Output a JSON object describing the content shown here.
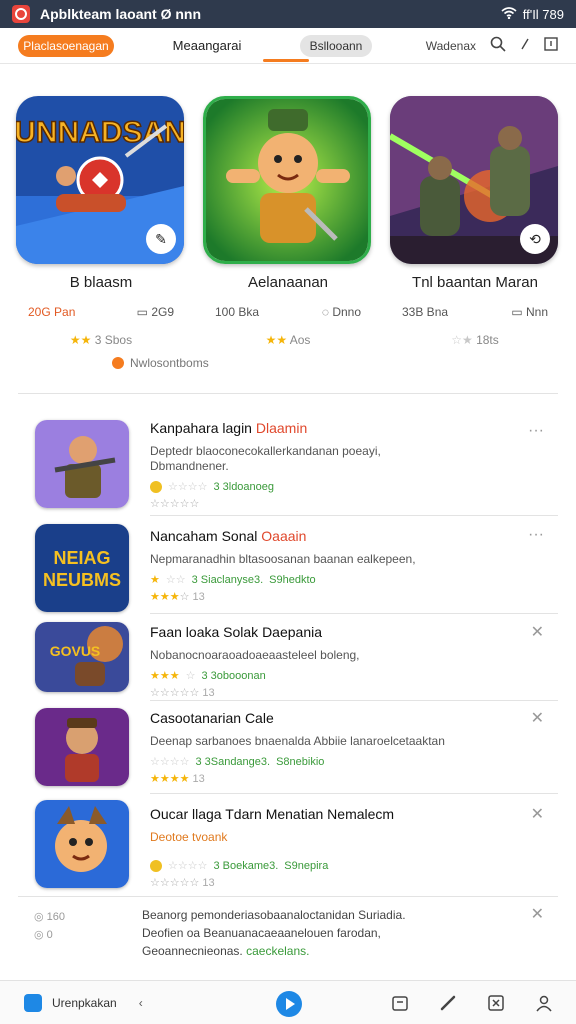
{
  "status_bar": {
    "title": "Apblkteam laoant Ø nnn",
    "right_text": "ff'Il 789"
  },
  "tabs": {
    "active": "Placlasoenagan",
    "plain": "Meaangarai",
    "grey": "Bsllooann",
    "right_label": "Wadenax"
  },
  "featured": [
    {
      "title": "B blaasm",
      "price": "20G Pan",
      "stat": "2G9",
      "rating_text": "3 Sbos",
      "cover_text": "UNNADSAN"
    },
    {
      "title": "Aelanaanan",
      "price": "100 Bka",
      "stat": "Dnno",
      "rating_text": "Aos",
      "cover_text": ""
    },
    {
      "title": "Tnl baantan Maran",
      "price": "33B Bna",
      "stat": "Nnn",
      "rating_text": "18ts",
      "cover_text": ""
    }
  ],
  "featured_note": "Nwlosontboms",
  "list": [
    {
      "title": "Kanpahara lagin",
      "title_accent": "Dlaamin",
      "desc": "Deptedr blaoconecokallerkandanan poeayi,\nDbmandnener.",
      "stats": "3 3ldoanoeg",
      "extra": "",
      "action": "···"
    },
    {
      "title": "Nancaham Sonal",
      "title_accent": "Oaaain",
      "desc": "Nepmaranadhin bltasoosanan baanan ealkepeen,",
      "stats": "3 Siaclanyse3.",
      "extra": "S9hedkto",
      "action": "···"
    },
    {
      "title": "Faan loaka Solak Daepania",
      "title_accent": "",
      "desc": "Nobanocnoaraoadoaeaasteleel boleng,",
      "stats": "3 3obooonan",
      "extra": "",
      "action": "✕"
    },
    {
      "title": "Casootanarian Cale",
      "title_accent": "",
      "desc": "Deenap sarbanoes bnaenalda Abbiie lanaroelcetaaktan",
      "stats": "3 3Sandange3.",
      "extra": "S8nebikio",
      "action": "✕"
    },
    {
      "title": "Oucar llaga Tdarn Menatian Nemalecm",
      "title_accent": "",
      "desc": "Deotoe tvoank",
      "stats": "3 Boekame3.",
      "extra": "S9nepira",
      "action": "✕"
    }
  ],
  "footer_block": {
    "left_a": "160",
    "left_b": "0",
    "line1": "Beanorg pemonderiasobaanaloctanidan Suriadia.",
    "line2": "Deofien oa Beanuanacaeaanelouen farodan,",
    "line3_prefix": "Geoannecnieonas.",
    "line3_accent": "caeckelans.",
    "action": "✕"
  },
  "bottom_bar": {
    "label": "Urenpkakan",
    "chev": "‹"
  },
  "colors": {
    "accent": "#f57c1f",
    "status_bg": "#2f3a4d",
    "link_green": "#3a9a3a",
    "title_red": "#e0482c",
    "play_blue": "#1e88e5"
  },
  "icons": [
    "app-icon",
    "wifi-icon",
    "signal-icon",
    "search-icon",
    "filter-icon",
    "window-icon",
    "more-icon",
    "close-icon",
    "home-icon",
    "play-icon",
    "edit-icon",
    "link-icon",
    "box-icon",
    "person-icon"
  ]
}
